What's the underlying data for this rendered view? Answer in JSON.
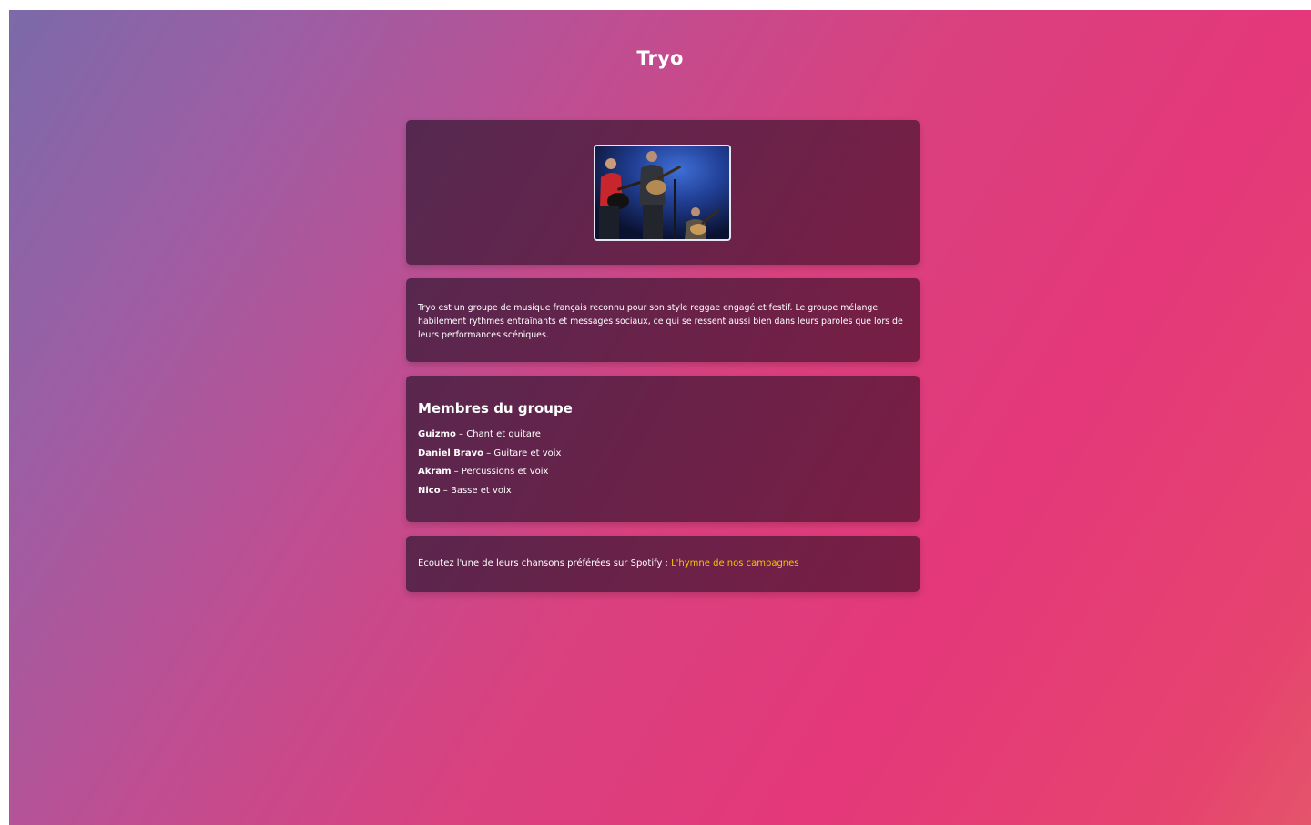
{
  "page": {
    "title": "Tryo"
  },
  "photo": {
    "alt": "Tryo sur scène"
  },
  "description": {
    "text": "Tryo est un groupe de musique français reconnu pour son style reggae engagé et festif. Le groupe mélange habilement rythmes entraînants et messages sociaux, ce qui se ressent aussi bien dans leurs paroles que lors de leurs performances scéniques."
  },
  "members": {
    "title": "Membres du groupe",
    "separator": " – ",
    "list": [
      {
        "name": "Guizmo",
        "role": "Chant et guitare"
      },
      {
        "name": "Daniel Bravo",
        "role": "Guitare et voix"
      },
      {
        "name": "Akram",
        "role": "Percussions et voix"
      },
      {
        "name": "Nico",
        "role": "Basse et voix"
      }
    ]
  },
  "spotify": {
    "text": "Écoutez l'une de leurs chansons préférées sur Spotify : ",
    "link_label": "L'hymne de nos campagnes"
  },
  "colors": {
    "link": "#f5c500",
    "text": "#ffffff"
  }
}
